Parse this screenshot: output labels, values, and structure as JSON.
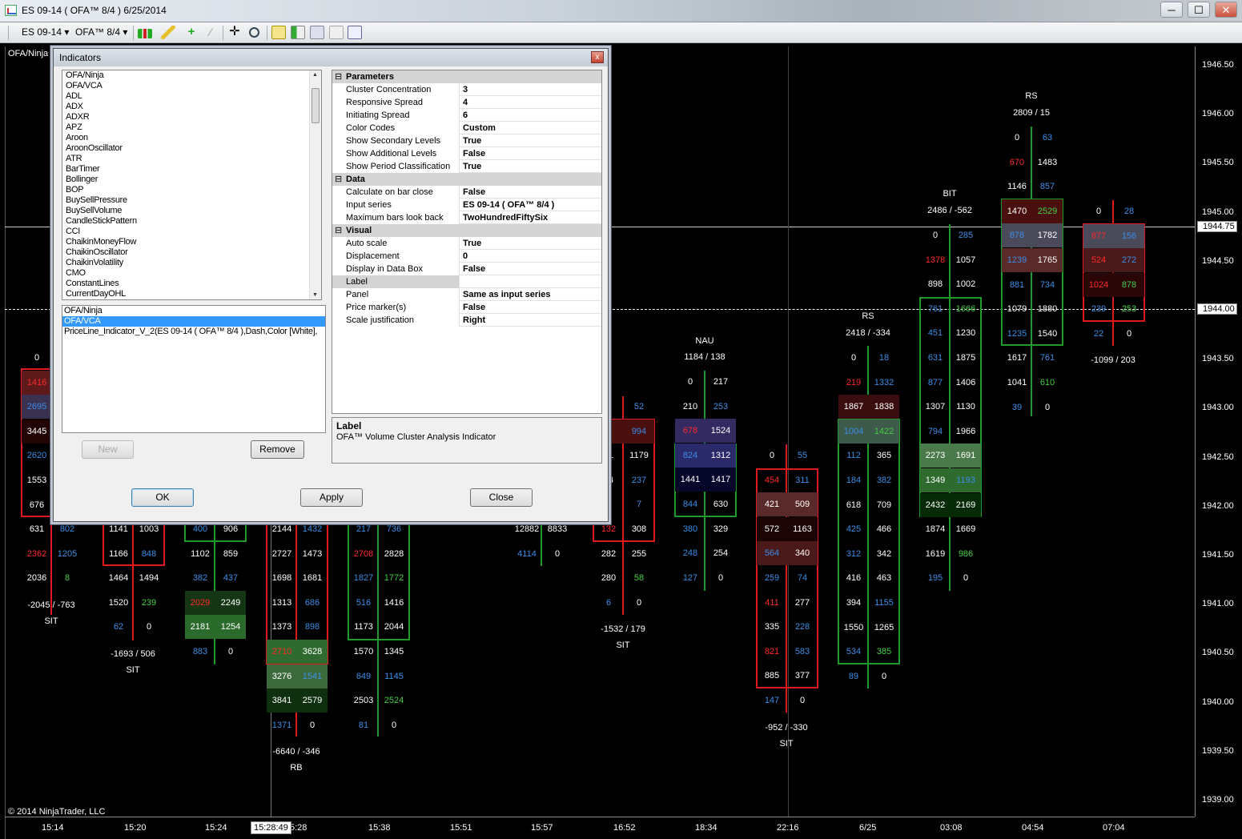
{
  "window": {
    "title": "ES 09-14 ( OFA™ 8/4 )  6/25/2014",
    "buttons": {
      "minimize": "─",
      "maximize": "☐",
      "close": "✕"
    }
  },
  "toolbar": {
    "instrument": "ES 09-14",
    "period": "OFA™ 8/4",
    "icons": [
      "bar-style-icon",
      "drawing-tools-icon",
      "add-marker-icon",
      "remove-drawing-icon",
      "crosshair-icon",
      "zoom-icon",
      "indicators-icon",
      "strategies-icon",
      "chart-properties-icon",
      "data-box-icon",
      "copy-icon"
    ]
  },
  "chart": {
    "top_left_label": "OFA/Ninja",
    "copyright": "© 2014 NinjaTrader, LLC",
    "price_axis": [
      "1946.50",
      "1946.00",
      "1945.50",
      "1945.00",
      "1944.50",
      "1944.00",
      "1943.50",
      "1943.00",
      "1942.50",
      "1942.00",
      "1941.50",
      "1941.00",
      "1940.50",
      "1940.00",
      "1939.50",
      "1939.00"
    ],
    "current_price_label": "1944.75",
    "priceline_label": "1944.00",
    "crosshair_time": "15:28:49",
    "time_axis": [
      "15:14",
      "15:20",
      "15:24",
      "5:28",
      "15:38",
      "15:51",
      "15:57",
      "16:52",
      "18:34",
      "22:16",
      "6/25",
      "03:08",
      "04:54",
      "07:04"
    ],
    "colors": {
      "up_box": "#1e9a2a",
      "down_box": "#e0191e",
      "bid_text": "#3b8ee8",
      "ask_text": "#ffffff",
      "red_text": "#ff2a2a",
      "green_text": "#44d044"
    }
  },
  "columns": [
    {
      "id": "c1",
      "top_label": "",
      "summary": "-2045 / -763",
      "classification": "SIT",
      "rows": [
        [
          "0",
          ""
        ],
        [
          "1416",
          ""
        ],
        [
          "2695",
          ""
        ],
        [
          "3445",
          ""
        ],
        [
          "2620",
          ""
        ],
        [
          "1553",
          ""
        ],
        [
          "676",
          ""
        ],
        [
          "631",
          "802"
        ],
        [
          "2362",
          "1205"
        ],
        [
          "2036",
          "8"
        ]
      ]
    },
    {
      "id": "c2",
      "summary": "-1693 / 506",
      "classification": "SIT",
      "rows": [
        [
          "1141",
          "1003"
        ],
        [
          "1166",
          "848"
        ],
        [
          "1464",
          "1494"
        ],
        [
          "1520",
          "239"
        ],
        [
          "62",
          "0"
        ]
      ]
    },
    {
      "id": "c3",
      "summary": "",
      "classification": "",
      "rows": [
        [
          "400",
          "906"
        ],
        [
          "1102",
          "859"
        ],
        [
          "382",
          "437"
        ],
        [
          "2029",
          "2249"
        ],
        [
          "2181",
          "1254"
        ],
        [
          "883",
          "0"
        ]
      ]
    },
    {
      "id": "c4",
      "summary": "-6640 / -346",
      "classification": "RB",
      "rows": [
        [
          "2144",
          "1432"
        ],
        [
          "2727",
          "1473"
        ],
        [
          "1698",
          "1681"
        ],
        [
          "1313",
          "686"
        ],
        [
          "1373",
          "898"
        ],
        [
          "2710",
          "3628"
        ],
        [
          "3276",
          "1541"
        ],
        [
          "3841",
          "2579"
        ],
        [
          "1371",
          "0"
        ]
      ]
    },
    {
      "id": "c5",
      "summary": "",
      "classification": "",
      "rows": [
        [
          "217",
          "736"
        ],
        [
          "2708",
          "2828"
        ],
        [
          "1827",
          "1772"
        ],
        [
          "516",
          "1416"
        ],
        [
          "1173",
          "2044"
        ],
        [
          "1570",
          "1345"
        ],
        [
          "649",
          "1145"
        ],
        [
          "2503",
          "2524"
        ],
        [
          "81",
          "0"
        ]
      ]
    },
    {
      "id": "c6",
      "summary": "",
      "classification": "",
      "rows": [
        [
          "12882",
          "8833"
        ],
        [
          "4114",
          "0"
        ]
      ]
    },
    {
      "id": "c7",
      "summary": "-1532 / 179",
      "classification": "SIT",
      "rows": [
        [
          "",
          "52"
        ],
        [
          "",
          "994"
        ],
        [
          "71",
          "1179"
        ],
        [
          "04",
          "237"
        ],
        [
          "1",
          "7"
        ],
        [
          "132",
          "308"
        ],
        [
          "282",
          "255"
        ],
        [
          "280",
          "58"
        ],
        [
          "6",
          "0"
        ]
      ]
    },
    {
      "id": "c8",
      "top_label": "NAU",
      "header": "1184 / 138",
      "summary": "",
      "classification": "",
      "rows": [
        [
          "0",
          "217"
        ],
        [
          "210",
          "253"
        ],
        [
          "678",
          "1524"
        ],
        [
          "824",
          "1312"
        ],
        [
          "1441",
          "1417"
        ],
        [
          "844",
          "630"
        ],
        [
          "380",
          "329"
        ],
        [
          "248",
          "254"
        ],
        [
          "127",
          "0"
        ]
      ]
    },
    {
      "id": "c9",
      "summary": "-952 / -330",
      "classification": "SIT",
      "rows": [
        [
          "0",
          "55"
        ],
        [
          "454",
          "311"
        ],
        [
          "421",
          "509"
        ],
        [
          "572",
          "1163"
        ],
        [
          "564",
          "340"
        ],
        [
          "259",
          "74"
        ],
        [
          "411",
          "277"
        ],
        [
          "335",
          "228"
        ],
        [
          "821",
          "583"
        ],
        [
          "885",
          "377"
        ],
        [
          "147",
          "0"
        ]
      ]
    },
    {
      "id": "c10",
      "top_label": "RS",
      "header": "2418 / -334",
      "summary": "",
      "classification": "",
      "rows": [
        [
          "0",
          "18"
        ],
        [
          "219",
          "1332"
        ],
        [
          "1867",
          "1838"
        ],
        [
          "1004",
          "1422"
        ],
        [
          "112",
          "365"
        ],
        [
          "184",
          "382"
        ],
        [
          "618",
          "709"
        ],
        [
          "425",
          "466"
        ],
        [
          "312",
          "342"
        ],
        [
          "416",
          "463"
        ],
        [
          "394",
          "1155"
        ],
        [
          "1550",
          "1265"
        ],
        [
          "534",
          "385"
        ],
        [
          "89",
          "0"
        ]
      ]
    },
    {
      "id": "c11",
      "top_label": "BIT",
      "header": "2486 / -562",
      "summary": "",
      "classification": "",
      "rows": [
        [
          "0",
          "285"
        ],
        [
          "1378",
          "1057"
        ],
        [
          "898",
          "1002"
        ],
        [
          "761",
          "1666"
        ],
        [
          "451",
          "1230"
        ],
        [
          "631",
          "1875"
        ],
        [
          "877",
          "1406"
        ],
        [
          "1307",
          "1130"
        ],
        [
          "794",
          "1966"
        ],
        [
          "2273",
          "1691"
        ],
        [
          "1349",
          "1193"
        ],
        [
          "2432",
          "2169"
        ],
        [
          "1874",
          "1669"
        ],
        [
          "1619",
          "986"
        ],
        [
          "195",
          "0"
        ]
      ]
    },
    {
      "id": "c12",
      "top_label": "RS",
      "header": "2809 / 15",
      "summary": "",
      "classification": "",
      "rows": [
        [
          "0",
          "63"
        ],
        [
          "670",
          "1483"
        ],
        [
          "1146",
          "857"
        ],
        [
          "1470",
          "2529"
        ],
        [
          "878",
          "1782"
        ],
        [
          "1239",
          "1765"
        ],
        [
          "881",
          "734"
        ],
        [
          "1079",
          "1880"
        ],
        [
          "1235",
          "1540"
        ],
        [
          "1617",
          "761"
        ],
        [
          "1041",
          "610"
        ],
        [
          "39",
          "0"
        ]
      ]
    },
    {
      "id": "c13",
      "summary": "-1099 / 203",
      "classification": "",
      "rows": [
        [
          "0",
          "28"
        ],
        [
          "877",
          "156"
        ],
        [
          "524",
          "272"
        ],
        [
          "1024",
          "878"
        ],
        [
          "239",
          "253"
        ],
        [
          "22",
          "0"
        ]
      ]
    }
  ],
  "dialog": {
    "title": "Indicators",
    "close": "x",
    "available": [
      "OFA/Ninja",
      " OFA/VCA",
      "ADL",
      "ADX",
      "ADXR",
      "APZ",
      "Aroon",
      "AroonOscillator",
      "ATR",
      "BarTimer",
      "Bollinger",
      "BOP",
      "BuySellPressure",
      "BuySellVolume",
      "CandleStickPattern",
      "CCI",
      "ChaikinMoneyFlow",
      "ChaikinOscillator",
      "ChaikinVolatility",
      "CMO",
      "ConstantLines",
      "CurrentDayOHL"
    ],
    "added": [
      "OFA/Ninja",
      "OFA/VCA",
      "PriceLine_Indicator_V_2(ES 09-14 ( OFA™ 8/4 ),Dash,Color [White],"
    ],
    "buttons": {
      "new": "New",
      "remove": "Remove",
      "ok": "OK",
      "apply": "Apply",
      "close": "Close"
    },
    "categories": {
      "parameters": "Parameters",
      "data": "Data",
      "visual": "Visual"
    },
    "parameters": [
      {
        "name": "Cluster Concentration",
        "value": "3"
      },
      {
        "name": "Responsive Spread",
        "value": "4"
      },
      {
        "name": "Initiating Spread",
        "value": "6"
      },
      {
        "name": "Color Codes",
        "value": "Custom"
      },
      {
        "name": "Show Secondary Levels",
        "value": "True"
      },
      {
        "name": "Show Additional Levels",
        "value": "False"
      },
      {
        "name": "Show Period Classification",
        "value": "True"
      }
    ],
    "data_props": [
      {
        "name": "Calculate on bar close",
        "value": "False"
      },
      {
        "name": "Input series",
        "value": "ES 09-14 ( OFA™ 8/4 )"
      },
      {
        "name": "Maximum bars look back",
        "value": "TwoHundredFiftySix"
      }
    ],
    "visual_props": [
      {
        "name": "Auto scale",
        "value": "True"
      },
      {
        "name": "Displacement",
        "value": "0"
      },
      {
        "name": "Display in Data Box",
        "value": "False"
      },
      {
        "name": "Label",
        "value": ""
      },
      {
        "name": "Panel",
        "value": "Same as input series"
      },
      {
        "name": "Price marker(s)",
        "value": "False"
      },
      {
        "name": "Scale justification",
        "value": "Right"
      }
    ],
    "description": {
      "title": "Label",
      "text": "OFA™ Volume Cluster Analysis Indicator"
    }
  }
}
